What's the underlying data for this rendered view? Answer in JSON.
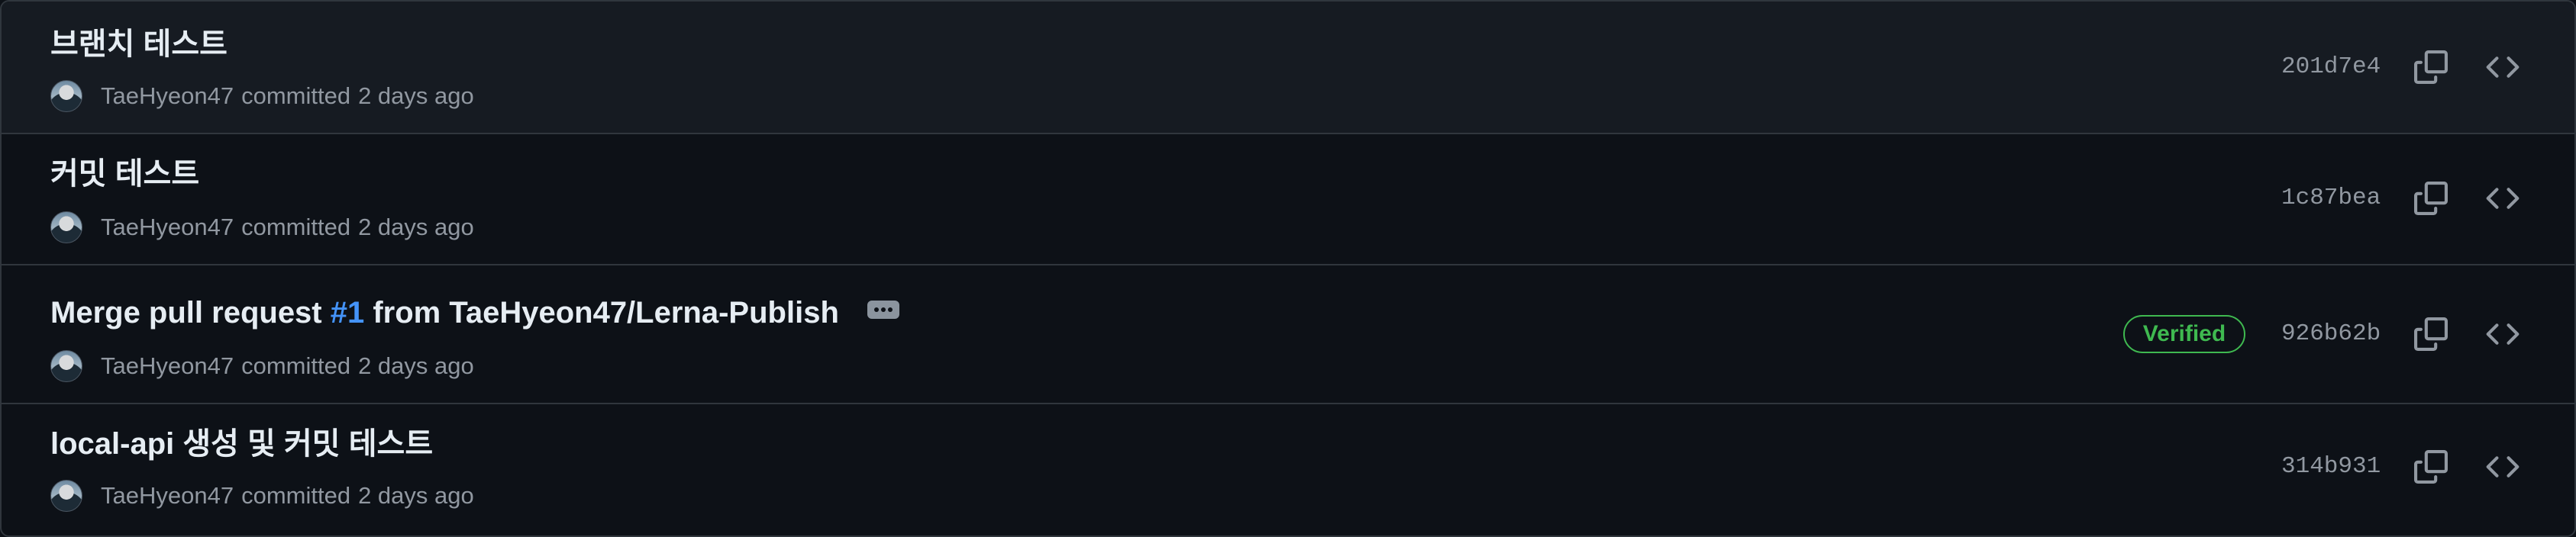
{
  "commits": [
    {
      "title_parts": [
        "브랜치 테스트"
      ],
      "author": "TaeHyeon47",
      "action": "committed",
      "time": "2 days ago",
      "sha": "201d7e4"
    },
    {
      "title_parts": [
        "커밋 테스트"
      ],
      "author": "TaeHyeon47",
      "action": "committed",
      "time": "2 days ago",
      "sha": "1c87bea"
    },
    {
      "title_parts": [
        "Merge pull request ",
        "#1",
        " from TaeHyeon47/Lerna-Publish"
      ],
      "author": "TaeHyeon47",
      "action": "committed",
      "time": "2 days ago",
      "badge": "Verified",
      "sha": "926b62b"
    },
    {
      "title_parts": [
        "local-api 생성 및 커밋 테스트"
      ],
      "author": "TaeHyeon47",
      "action": "committed",
      "time": "2 days ago",
      "sha": "314b931"
    }
  ],
  "icons": {
    "copy": "copy-icon",
    "browse": "code-icon",
    "more": "kebab-horizontal-icon"
  },
  "colors": {
    "background": "#0d1117",
    "highlight_row": "#161b22",
    "border": "#30363d",
    "title": "#e6edf3",
    "muted": "#9198a1",
    "link": "#4493f8",
    "verified": "#3fb950"
  }
}
